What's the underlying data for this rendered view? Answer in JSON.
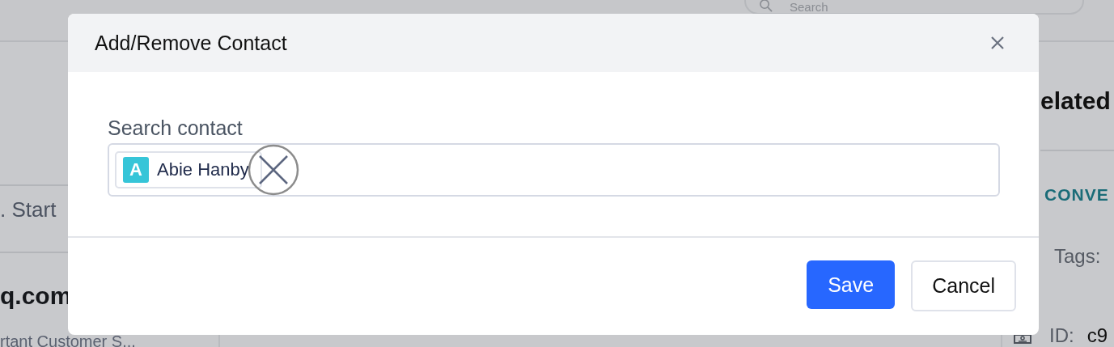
{
  "background": {
    "search": {
      "placeholder": "Search"
    },
    "list_items": [
      {
        "kind": "line",
        "text": ". Start"
      },
      {
        "kind": "contact",
        "title": "q.com",
        "subtitle": "rtant Customer S..."
      }
    ],
    "side_panel": {
      "heading": "elated",
      "section": "CONVE",
      "tags_label": "Tags:",
      "id_label": "ID:",
      "id_value": "c9"
    }
  },
  "dialog": {
    "title": "Add/Remove Contact",
    "field_label": "Search contact",
    "chips": [
      {
        "initial": "A",
        "name": "Abie Hanby"
      }
    ],
    "buttons": [
      {
        "label": "Save",
        "kind": "primary"
      },
      {
        "label": "Cancel",
        "kind": "secondary"
      }
    ]
  }
}
